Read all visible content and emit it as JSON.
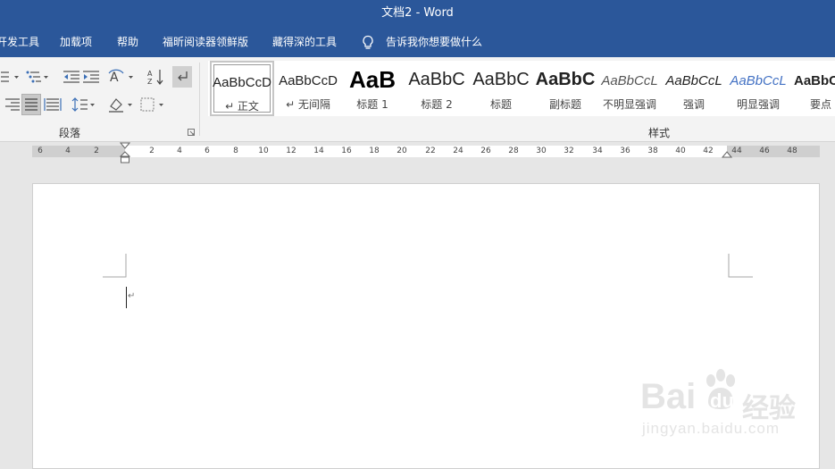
{
  "window": {
    "title": "文档2  -  Word"
  },
  "menu": {
    "items": [
      "开发工具",
      "加载项",
      "帮助",
      "福昕阅读器领鲜版",
      "藏得深的工具"
    ],
    "tell_me": "告诉我你想要做什么"
  },
  "ribbon": {
    "paragraph_group": {
      "label": "段落"
    },
    "styles_group": {
      "label": "样式",
      "styles": [
        {
          "sample": "AaBbCcD",
          "name": "↵ 正文",
          "selected": true
        },
        {
          "sample": "AaBbCcD",
          "name": "↵ 无间隔"
        },
        {
          "sample": "AaB",
          "name": "标题 1"
        },
        {
          "sample": "AaBbC",
          "name": "标题 2"
        },
        {
          "sample": "AaBbC",
          "name": "标题"
        },
        {
          "sample": "AaBbC",
          "name": "副标题"
        },
        {
          "sample": "AaBbCcL",
          "name": "不明显强调"
        },
        {
          "sample": "AaBbCcL",
          "name": "强调"
        },
        {
          "sample": "AaBbCcL",
          "name": "明显强调"
        },
        {
          "sample": "AaBbC",
          "name": "要点"
        }
      ]
    }
  },
  "ruler": {
    "left_labels": [
      "6",
      "4",
      "2"
    ],
    "labels": [
      "2",
      "4",
      "6",
      "8",
      "10",
      "12",
      "14",
      "16",
      "18",
      "20",
      "22",
      "24",
      "26",
      "28",
      "30",
      "32",
      "34",
      "36",
      "38",
      "40",
      "42"
    ],
    "right_labels": [
      "44",
      "46",
      "48"
    ]
  },
  "document": {
    "paragraph_mark": "↵"
  },
  "watermark": {
    "brand": "Bai",
    "brand2": "du",
    "cn": "经验",
    "url": "jingyan.baidu.com"
  },
  "colors": {
    "accent": "#2b579a",
    "ribbon_bg": "#f3f3f3",
    "workspace_bg": "#e6e6e6"
  }
}
